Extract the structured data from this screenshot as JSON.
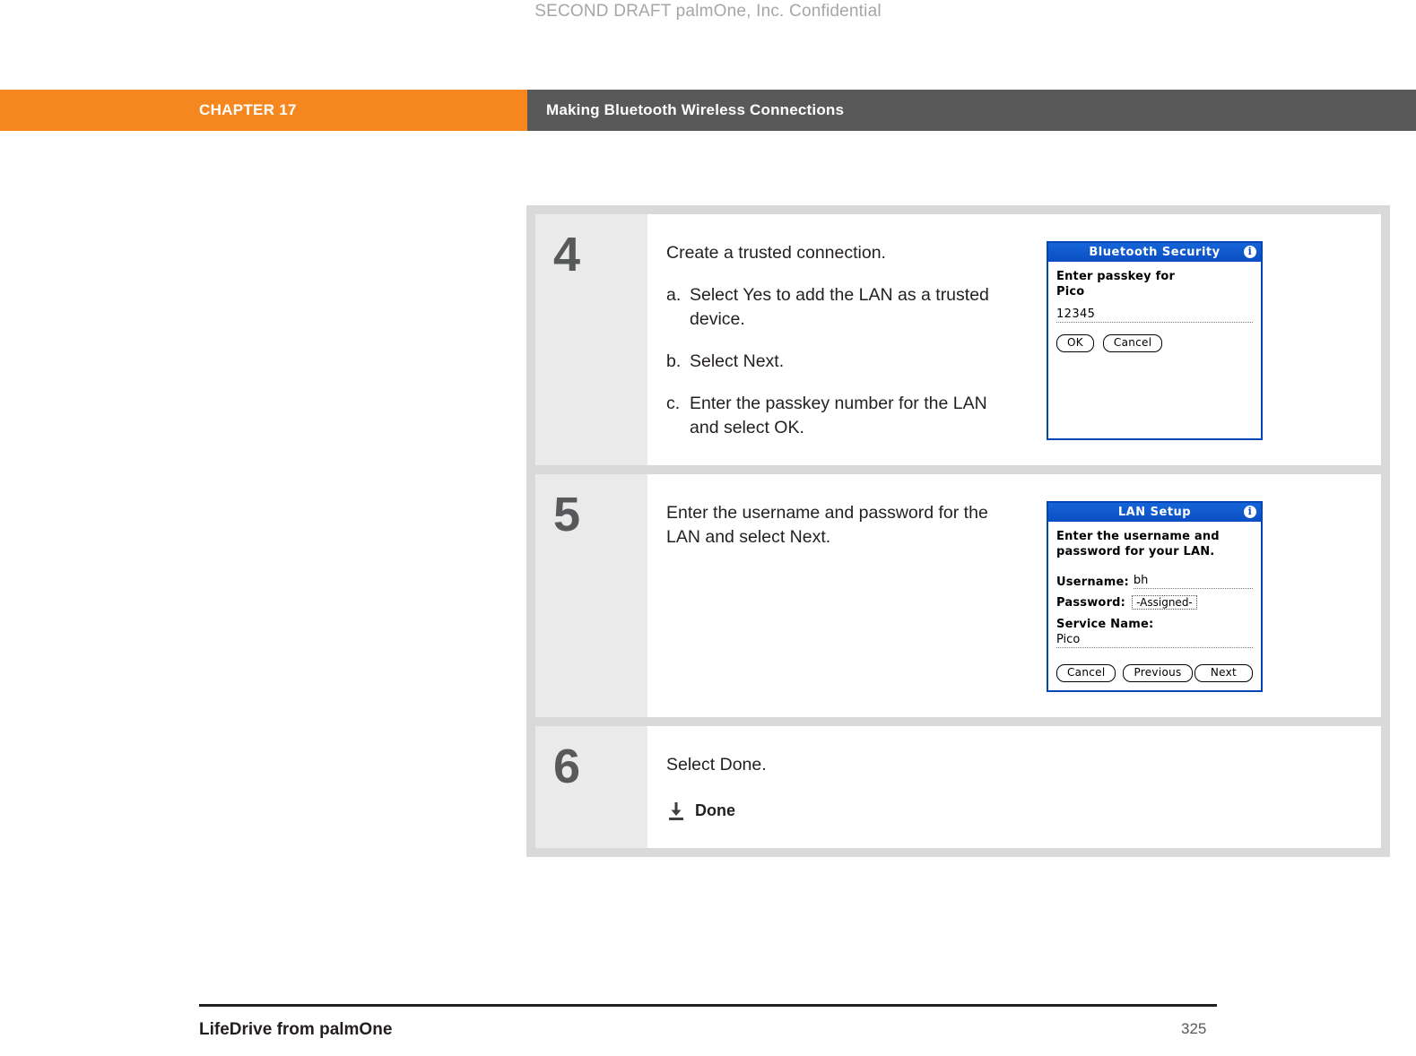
{
  "header": {
    "draft_notice": "SECOND DRAFT palmOne, Inc.  Confidential"
  },
  "chapter_bar": {
    "chapter_label": "CHAPTER 17",
    "chapter_title": "Making Bluetooth Wireless Connections",
    "accent_color": "#f6871f",
    "title_bg_color": "#595959"
  },
  "steps": [
    {
      "number": "4",
      "intro": "Create a trusted connection.",
      "substeps": [
        {
          "letter": "a.",
          "text": "Select Yes to add the LAN as a trusted device."
        },
        {
          "letter": "b.",
          "text": "Select Next."
        },
        {
          "letter": "c.",
          "text": "Enter the passkey number for the LAN and select OK."
        }
      ],
      "screen": {
        "title": "Bluetooth Security",
        "info_icon": "i",
        "prompt_line1": "Enter passkey for",
        "prompt_line2": "Pico",
        "passkey_value": "12345",
        "ok_label": "OK",
        "cancel_label": "Cancel"
      }
    },
    {
      "number": "5",
      "intro": "Enter the username and password for the LAN and select Next.",
      "screen": {
        "title": "LAN Setup",
        "info_icon": "i",
        "prompt_line1": "Enter the username and",
        "prompt_line2": "password for your LAN.",
        "username_label": "Username:",
        "username_value": "bh",
        "password_label": "Password:",
        "password_value": "-Assigned-",
        "service_label": "Service Name:",
        "service_value": "Pico",
        "cancel_label": "Cancel",
        "previous_label": "Previous",
        "next_label": "Next"
      }
    },
    {
      "number": "6",
      "intro": "Select Done.",
      "done": {
        "icon": "done-arrow-icon",
        "label": "Done"
      }
    }
  ],
  "footer": {
    "book_title": "LifeDrive from palmOne",
    "page_number": "325"
  }
}
